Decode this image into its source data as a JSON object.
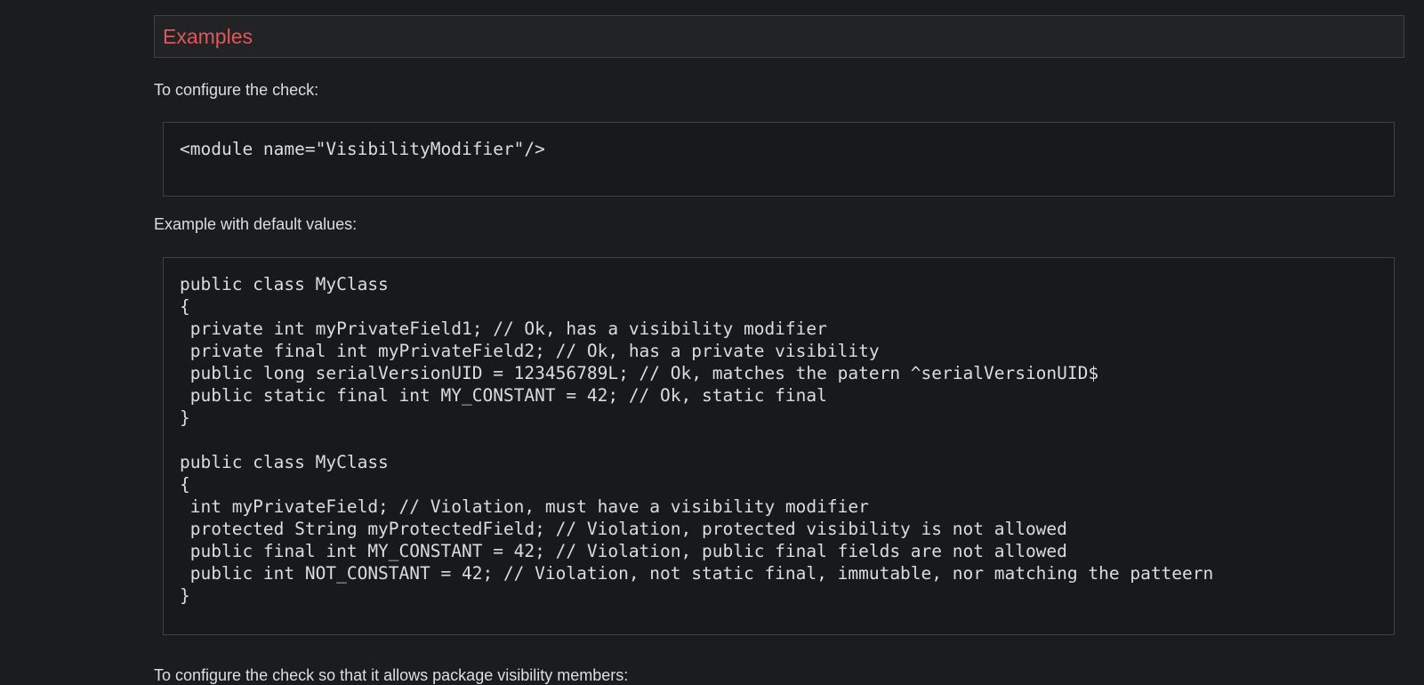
{
  "section": {
    "title": "Examples"
  },
  "paragraphs": {
    "configure": "To configure the check:",
    "example_default": "Example with default values:",
    "next_partial": "To configure the check so that it allows package visibility members:"
  },
  "code_blocks": {
    "config": "<module name=\"VisibilityModifier\"/>",
    "example": "public class MyClass\n{\n private int myPrivateField1; // Ok, has a visibility modifier\n private final int myPrivateField2; // Ok, has a private visibility\n public long serialVersionUID = 123456789L; // Ok, matches the patern ^serialVersionUID$\n public static final int MY_CONSTANT = 42; // Ok, static final\n}\n\npublic class MyClass\n{\n int myPrivateField; // Violation, must have a visibility modifier\n protected String myProtectedField; // Violation, protected visibility is not allowed\n public final int MY_CONSTANT = 42; // Violation, public final fields are not allowed\n public int NOT_CONSTANT = 42; // Violation, not static final, immutable, nor matching the patteern\n}"
  }
}
